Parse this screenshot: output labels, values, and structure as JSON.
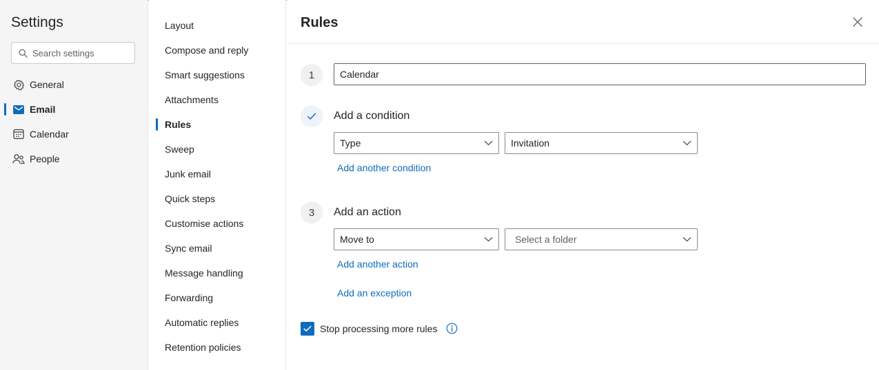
{
  "settings": {
    "title": "Settings",
    "search_placeholder": "Search settings"
  },
  "nav": {
    "items": [
      {
        "label": "General",
        "icon": "gear-icon"
      },
      {
        "label": "Email",
        "icon": "mail-icon",
        "active": true
      },
      {
        "label": "Calendar",
        "icon": "calendar-icon"
      },
      {
        "label": "People",
        "icon": "people-icon"
      }
    ]
  },
  "email_menu": {
    "items": [
      {
        "label": "Layout"
      },
      {
        "label": "Compose and reply"
      },
      {
        "label": "Smart suggestions"
      },
      {
        "label": "Attachments"
      },
      {
        "label": "Rules",
        "active": true
      },
      {
        "label": "Sweep"
      },
      {
        "label": "Junk email"
      },
      {
        "label": "Quick steps"
      },
      {
        "label": "Customise actions"
      },
      {
        "label": "Sync email"
      },
      {
        "label": "Message handling"
      },
      {
        "label": "Forwarding"
      },
      {
        "label": "Automatic replies"
      },
      {
        "label": "Retention policies"
      }
    ]
  },
  "rules": {
    "title": "Rules",
    "step1": {
      "number": "1",
      "value": "Calendar"
    },
    "step2": {
      "label": "Add a condition",
      "condition_type": "Type",
      "condition_value": "Invitation",
      "add_link": "Add another condition"
    },
    "step3": {
      "number": "3",
      "label": "Add an action",
      "action_type": "Move to",
      "folder_placeholder": "Select a folder",
      "add_link": "Add another action"
    },
    "exception_link": "Add an exception",
    "stop_processing_label": "Stop processing more rules"
  },
  "colors": {
    "accent": "#0f6cbd",
    "sidebar_bg": "#f5f5f5"
  }
}
